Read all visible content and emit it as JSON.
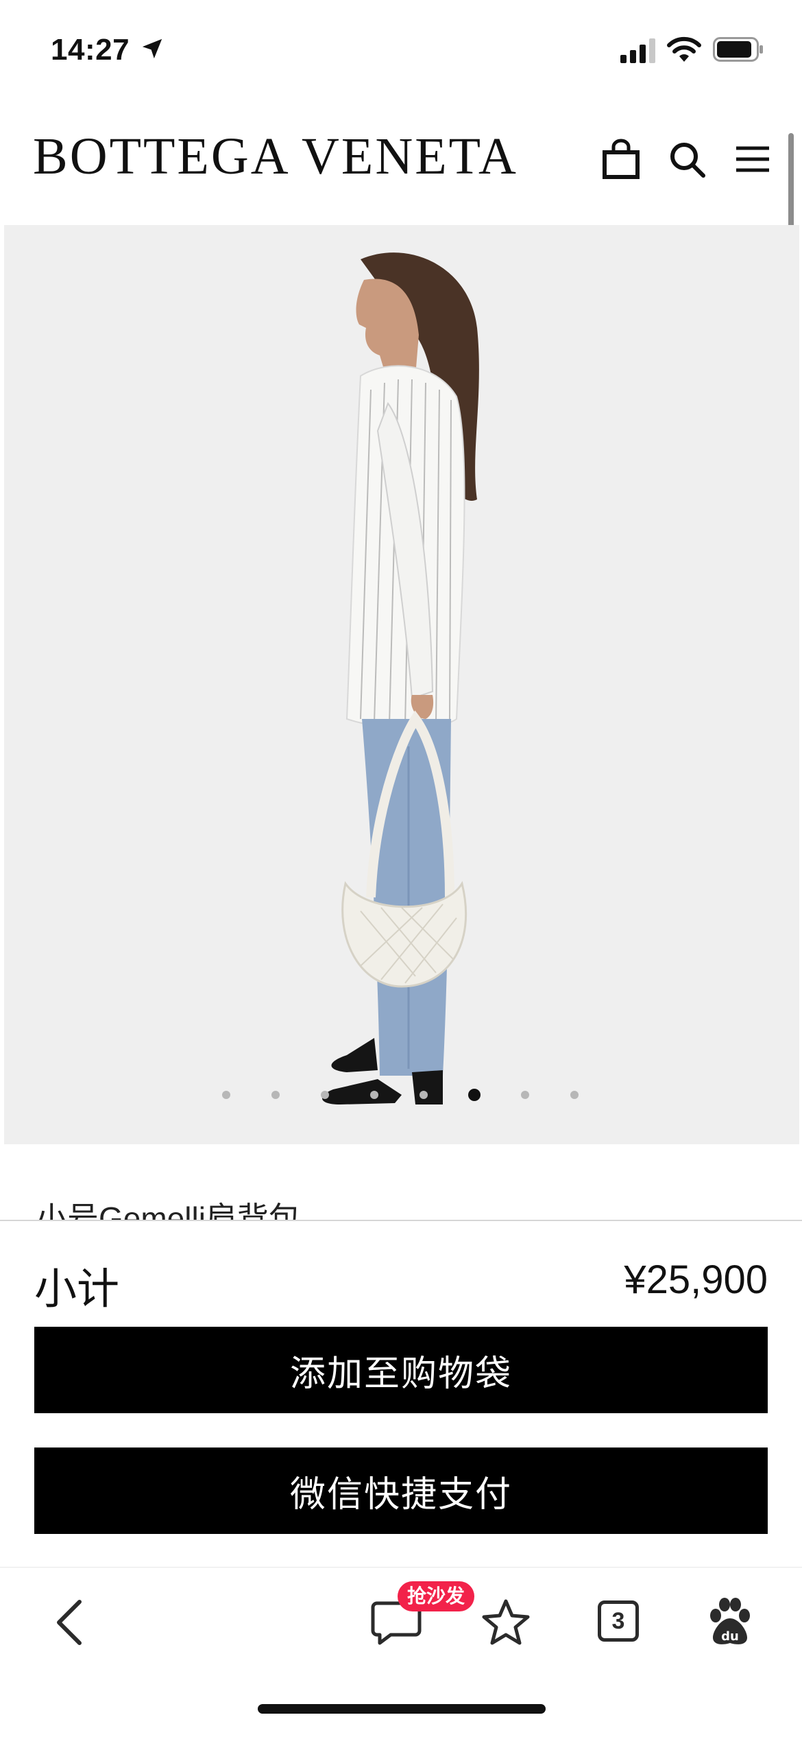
{
  "status_bar": {
    "time": "14:27",
    "icons": [
      "location-arrow-icon",
      "signal-icon",
      "wifi-icon",
      "battery-icon"
    ]
  },
  "header": {
    "brand": "BOTTEGA VENETA",
    "icons": [
      "shopping-bag-icon",
      "search-icon",
      "menu-icon"
    ]
  },
  "gallery": {
    "image_count": 8,
    "active_index": 5
  },
  "product": {
    "title": "小号Gemelli肩背包"
  },
  "purchase": {
    "subtotal_label": "小计",
    "subtotal_price": "¥25,900",
    "add_to_bag": "添加至购物袋",
    "wechat_pay": "微信快捷支付"
  },
  "toolbar": {
    "badge": "抢沙发",
    "tab_count": "3",
    "icons": [
      "back-icon",
      "comment-icon",
      "star-icon",
      "tabs-icon",
      "baidu-paw-icon"
    ]
  },
  "colors": {
    "button_bg": "#000000",
    "image_bg": "#efefef",
    "badge_bg": "#f2224a"
  }
}
